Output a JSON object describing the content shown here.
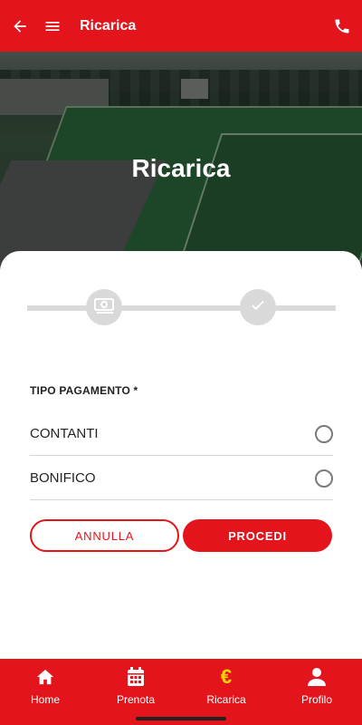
{
  "header": {
    "title": "Ricarica"
  },
  "hero": {
    "title": "Ricarica"
  },
  "form": {
    "payment_type_label": "TIPO PAGAMENTO *",
    "options": [
      {
        "label": "CONTANTI",
        "selected": false
      },
      {
        "label": "BONIFICO",
        "selected": false
      }
    ],
    "cancel_label": "ANNULLA",
    "proceed_label": "PROCEDI"
  },
  "stepper": {
    "steps": [
      {
        "icon": "cash-icon"
      },
      {
        "icon": "check-icon"
      }
    ]
  },
  "bottom_nav": {
    "items": [
      {
        "label": "Home",
        "icon": "home-icon"
      },
      {
        "label": "Prenota",
        "icon": "calendar-icon"
      },
      {
        "label": "Ricarica",
        "icon": "euro-icon",
        "active": true,
        "icon_color": "#ffd400"
      },
      {
        "label": "Profilo",
        "icon": "user-icon"
      }
    ]
  },
  "colors": {
    "primary": "#e3141b",
    "accent": "#ffd400"
  }
}
